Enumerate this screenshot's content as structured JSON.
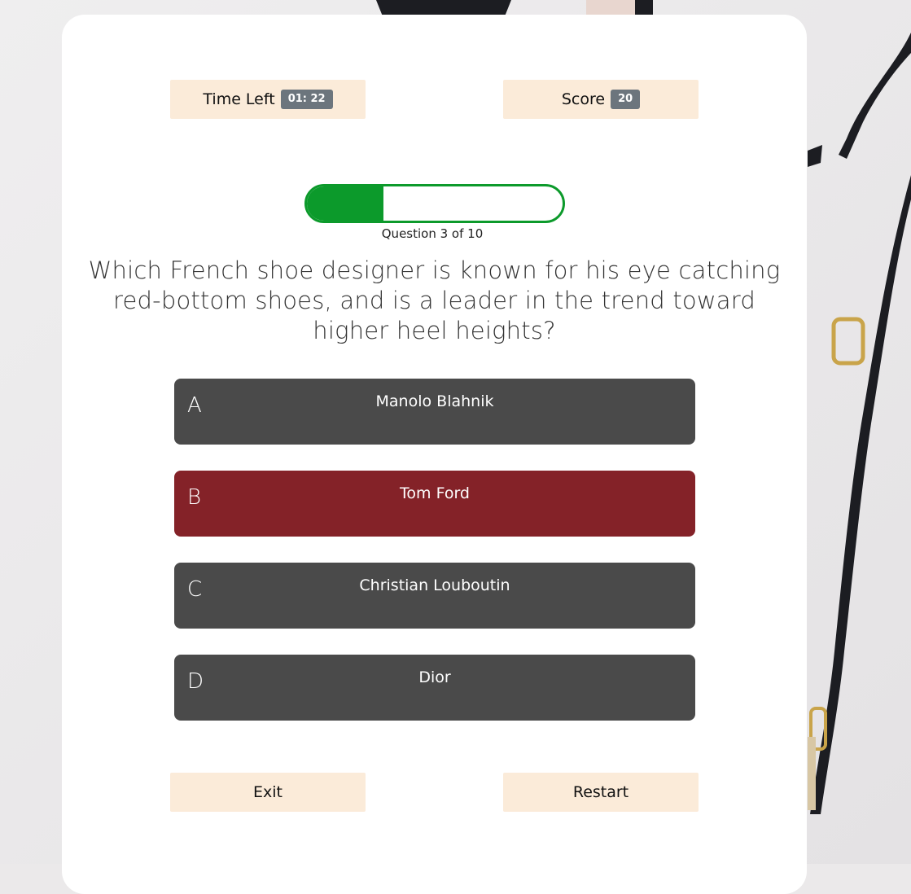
{
  "header": {
    "time_label": "Time Left",
    "time_value": "01: 22",
    "score_label": "Score",
    "score_value": "20"
  },
  "progress": {
    "fraction": 0.3,
    "label": "Question 3 of 10"
  },
  "question": {
    "text": "Which French shoe designer is known for his eye catching red-bottom shoes, and is a leader in the trend toward higher heel heights?"
  },
  "answers": [
    {
      "letter": "A",
      "text": "Manolo Blahnik",
      "selected": false
    },
    {
      "letter": "B",
      "text": "Tom Ford",
      "selected": true
    },
    {
      "letter": "C",
      "text": "Christian Louboutin",
      "selected": false
    },
    {
      "letter": "D",
      "text": "Dior",
      "selected": false
    }
  ],
  "footer": {
    "exit_label": "Exit",
    "restart_label": "Restart"
  },
  "colors": {
    "accent_green": "#0c9a2b",
    "selected_answer": "#842228",
    "answer_default": "#4a4a4a",
    "stat_box": "#fbebd9",
    "badge": "#6c757d"
  }
}
